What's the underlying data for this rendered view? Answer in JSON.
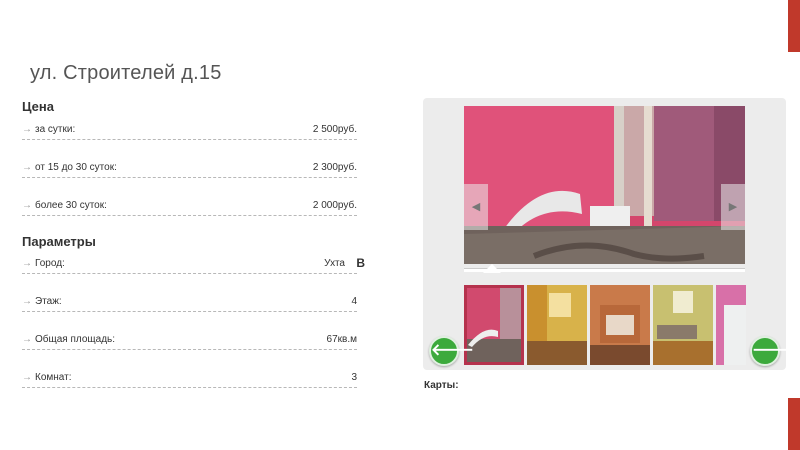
{
  "address": "ул. Строителей д.15",
  "price": {
    "title": "Цена",
    "rows": [
      {
        "label": "за сутки:",
        "value": "2 500руб."
      },
      {
        "label": "от 15 до 30 суток:",
        "value": "2 300руб."
      },
      {
        "label": "более 30 суток:",
        "value": "2 000руб."
      }
    ]
  },
  "params": {
    "title": "Параметры",
    "rows": [
      {
        "label": "Город:",
        "value": "Ухта",
        "value_suffix": "В"
      },
      {
        "label": "Этаж:",
        "value": "4"
      },
      {
        "label": "Общая площадь:",
        "value": "67кв.м"
      },
      {
        "label": "Комнат:",
        "value": "3"
      }
    ]
  },
  "gallery": {
    "prev_icon": "◀",
    "next_icon": "▶",
    "prev_thumbs_icon": "🡐",
    "next_thumbs_icon": "🡒"
  },
  "maps_label": "Карты:",
  "colors": {
    "accent": "#c0392b",
    "nav_green": "#3caa3c"
  }
}
